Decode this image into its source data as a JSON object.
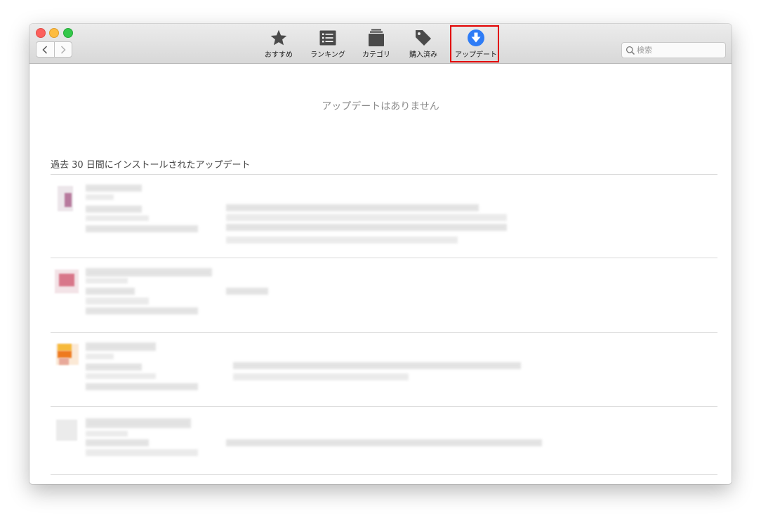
{
  "window": {
    "traffic_lights": [
      "close",
      "minimize",
      "zoom"
    ],
    "nav": {
      "back_icon": "chevron-left-icon",
      "forward_icon": "chevron-right-icon"
    }
  },
  "toolbar": {
    "items": [
      {
        "label": "おすすめ",
        "icon": "star-icon"
      },
      {
        "label": "ランキング",
        "icon": "list-icon"
      },
      {
        "label": "カテゴリ",
        "icon": "stack-icon"
      },
      {
        "label": "購入済み",
        "icon": "tag-icon"
      },
      {
        "label": "アップデート",
        "icon": "download-arrow-icon",
        "selected": true
      }
    ],
    "highlight_color": "#e20000",
    "accent": "#2e7cf6"
  },
  "search": {
    "placeholder": "検索"
  },
  "content": {
    "empty_message": "アップデートはありません",
    "section_title": "過去 30 日間にインストールされたアップデート",
    "installed_updates_blurred_rows": 4
  }
}
